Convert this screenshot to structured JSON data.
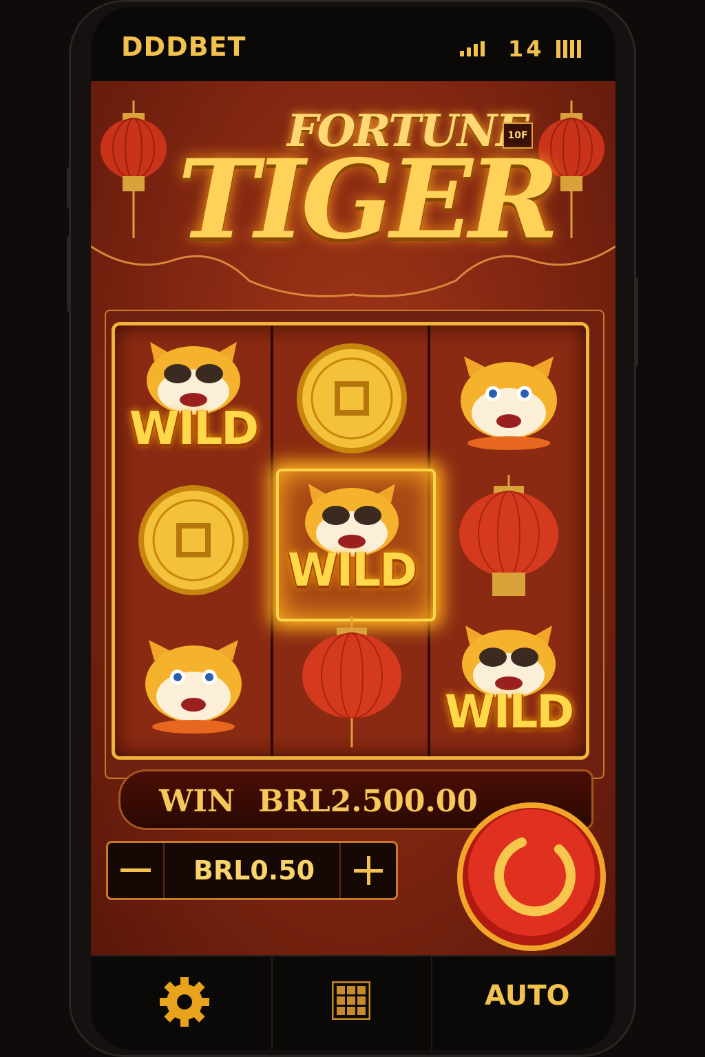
{
  "status_bar": {
    "brand": "DDDBET",
    "time": "14",
    "signal_icon": "signal-bars-icon",
    "battery_icon": "battery-icon"
  },
  "game": {
    "title_top": "FORTUNE",
    "title_main": "TIGER",
    "badge": "10F",
    "reels": [
      [
        "wild-tiger",
        "gold-coin",
        "tiger"
      ],
      [
        "gold-coin",
        "wild-tiger",
        "lantern"
      ],
      [
        "tiger",
        "lantern",
        "wild-tiger"
      ]
    ],
    "wild_label": "WILD",
    "win_label": "WIN",
    "win_amount": "BRL2.500.00",
    "bet_amount": "BRL0.50",
    "minus_symbol": "−",
    "plus_symbol": "+"
  },
  "toolbar": {
    "settings_icon": "gear-icon",
    "menu_icon": "grid-icon",
    "auto_label": "AUTO"
  },
  "colors": {
    "gold": "#f2c14e",
    "red_bg": "#7e2511",
    "spin_red": "#d8261a"
  }
}
